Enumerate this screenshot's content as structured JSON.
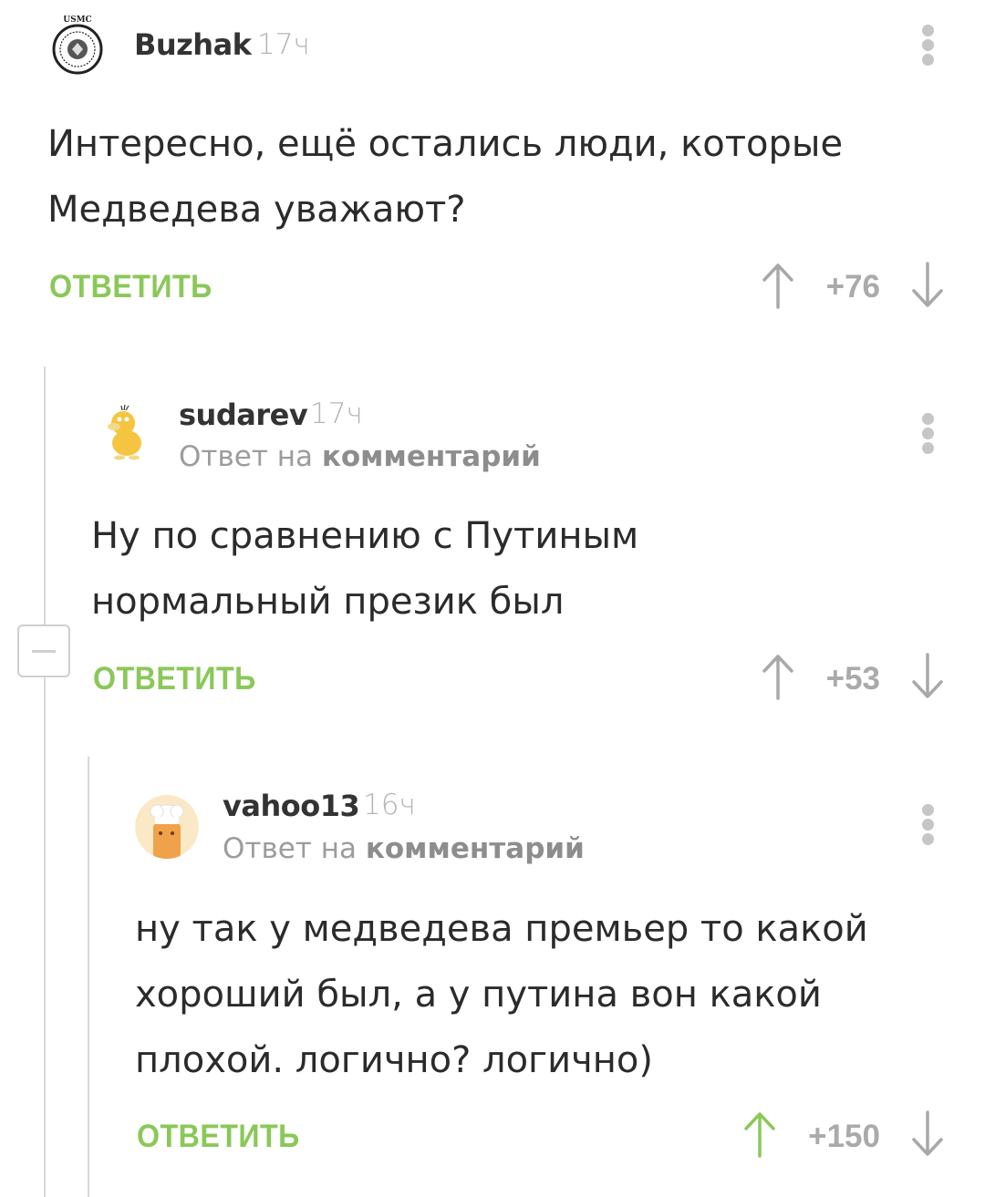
{
  "comments": [
    {
      "author": "Buzhak",
      "time": "17ч",
      "avatar_icon": "usmc-emblem",
      "avatar_text": "USMC",
      "text": [
        "Интересно, ещё остались люди, которые",
        "Медведева уважают?"
      ],
      "reply_label": "ОТВЕТИТЬ",
      "rating": "+76",
      "upvoted": false
    },
    {
      "author": "sudarev",
      "time": "17ч",
      "avatar_icon": "yellow-duck",
      "reply_to_prefix": "Ответ на",
      "reply_to_link": "комментарий",
      "text": [
        "Ну по сравнению с Путиным",
        "нормальный презик был"
      ],
      "reply_label": "ОТВЕТИТЬ",
      "rating": "+53",
      "upvoted": false
    },
    {
      "author": "vahoo13",
      "time": "16ч",
      "avatar_icon": "chef-hat-face",
      "reply_to_prefix": "Ответ на",
      "reply_to_link": "комментарий",
      "text": [
        "ну так у медведева премьер то какой",
        "хороший был, а у путина вон какой",
        "плохой. логично? логично)"
      ],
      "reply_label": "ОТВЕТИТЬ",
      "rating": "+150",
      "upvoted": true
    }
  ],
  "colors": {
    "accent_green": "#8ac858",
    "rating_gray": "#aaaaaa",
    "icon_gray": "#a8a8a8"
  }
}
